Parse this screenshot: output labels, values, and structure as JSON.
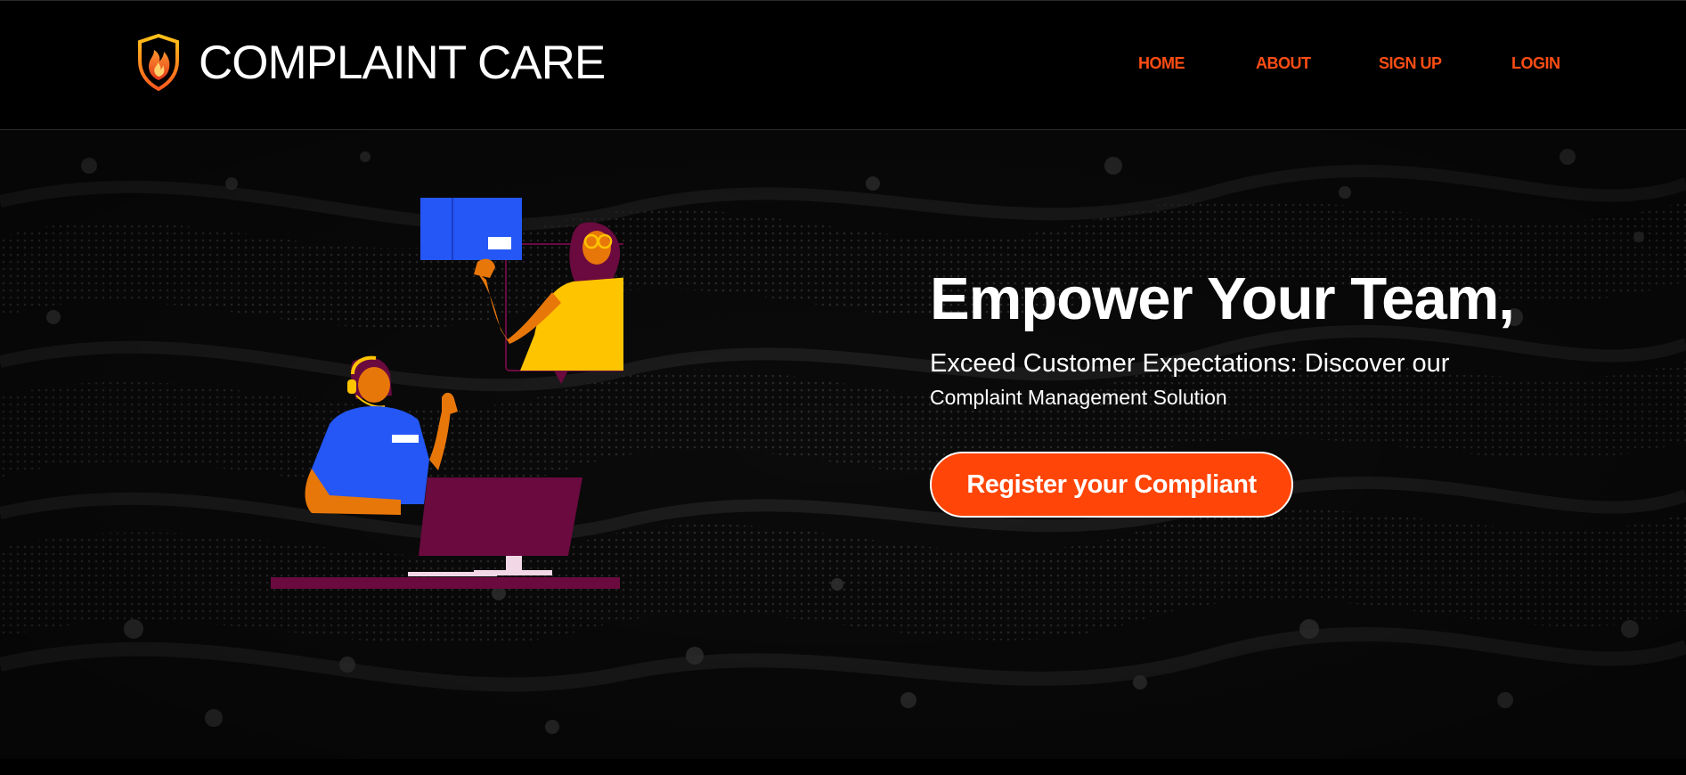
{
  "brand": {
    "name": "COMPLAINT CARE",
    "logo_icon": "shield-flame-icon"
  },
  "nav": {
    "home": "HOME",
    "about": "ABOUT",
    "signup": "SIGN UP",
    "login": "LOGIN"
  },
  "hero": {
    "title": "Empower Your Team,",
    "subtitle": "Exceed Customer Expectations: Discover our",
    "subtitle_line2": "Complaint Management Solution",
    "cta_label": "Register your Compliant",
    "illustration": "customer-support-illustration"
  },
  "colors": {
    "accent": "#ff4507",
    "nav_link": "#ff4d14",
    "background": "#000000",
    "hero_background": "#0c0c0c",
    "text": "#ffffff"
  }
}
